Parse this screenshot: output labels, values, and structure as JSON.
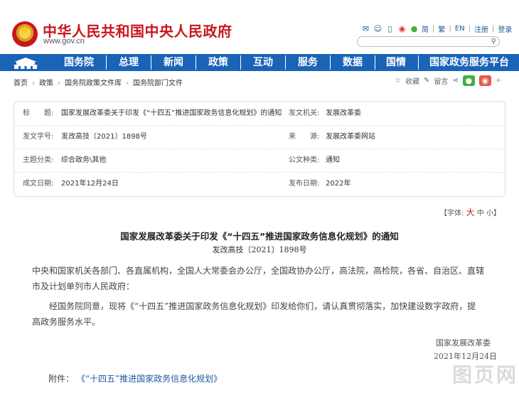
{
  "header": {
    "site_title": "中华人民共和国中央人民政府",
    "site_url": "www.gov.cn",
    "links": [
      "简",
      "繁",
      "EN",
      "注册",
      "登录"
    ]
  },
  "nav": {
    "items": [
      "国务院",
      "总理",
      "新闻",
      "政策",
      "互动",
      "服务",
      "数据",
      "国情",
      "国家政务服务平台"
    ]
  },
  "breadcrumb": {
    "items": [
      "首页",
      "政策",
      "国务院政策文件库",
      "国务院部门文件"
    ]
  },
  "tools": {
    "collect": "收藏",
    "comment": "留言"
  },
  "info": {
    "title_label": "标　　题:",
    "title_value": "国家发展改革委关于印发《“十四五”推进国家政务信息化规划》的通知",
    "issuer_label": "发文机关:",
    "issuer_value": "发展改革委",
    "docno_label": "发文字号:",
    "docno_value": "发改高技〔2021〕1898号",
    "source_label": "来　　源:",
    "source_value": "发展改革委网站",
    "topic_label": "主题分类:",
    "topic_value": "综合政务\\其他",
    "type_label": "公文种类:",
    "type_value": "通知",
    "written_label": "成文日期:",
    "written_value": "2021年12月24日",
    "published_label": "发布日期:",
    "published_value": "2022年"
  },
  "fontsize": {
    "prefix": "【字体:",
    "large": "大",
    "medium": "中",
    "small": "小】"
  },
  "article": {
    "title": "国家发展改革委关于印发《“十四五”推进国家政务信息化规划》的通知",
    "doc_no": "发改高技〔2021〕1898号",
    "para1_line1": "中央和国家机关各部门、各直属机构，全国人大常委会办公厅，全国政协办公厅，高法院，高检院，各省、自治区、直辖",
    "para1_line2": "市及计划单列市人民政府：",
    "para2_line1": "　　经国务院同意，现将《“十四五”推进国家政务信息化规划》印发给你们，请认真贯彻落实，加快建设数字政府，提",
    "para2_line2": "高政务服务水平。",
    "signer": "国家发展改革委",
    "date": "2021年12月24日",
    "attach_label": "附件：",
    "attach_link": "《“十四五”推进国家政务信息化规划》"
  },
  "watermark": "图页网"
}
